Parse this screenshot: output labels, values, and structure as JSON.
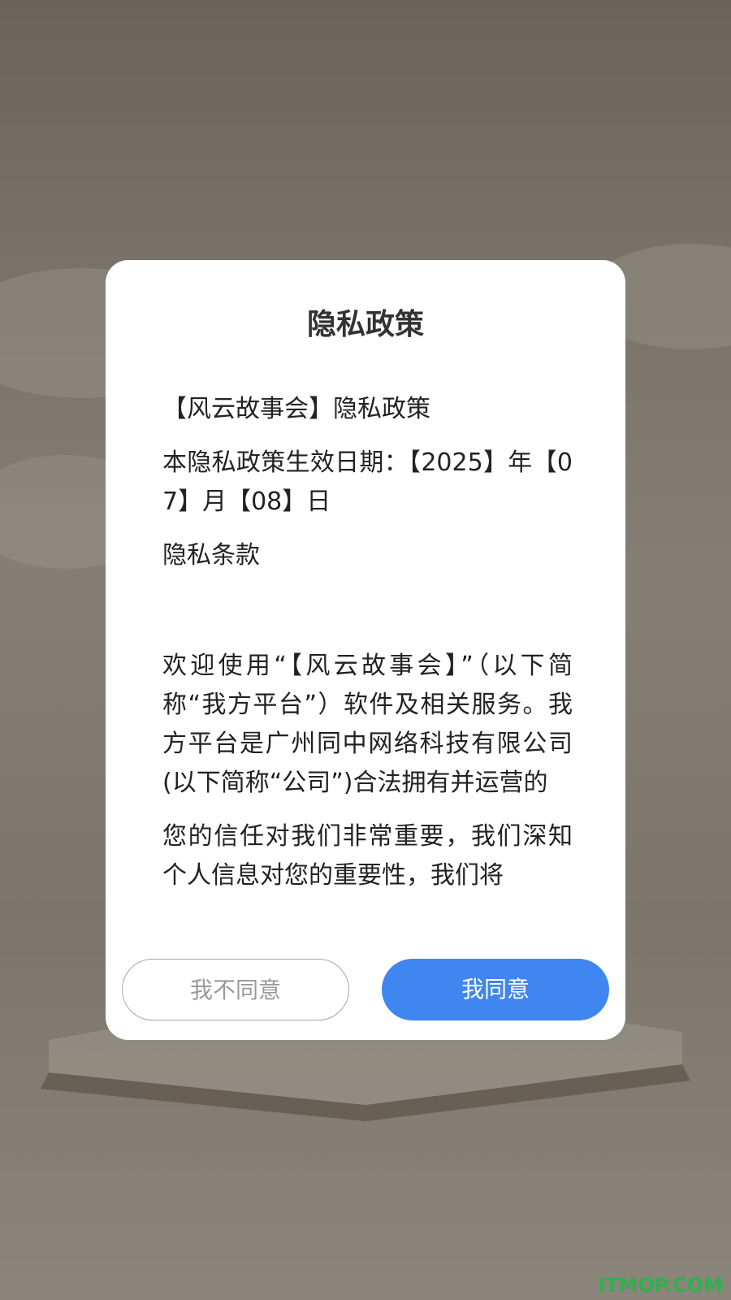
{
  "dialog": {
    "title": "隐私政策",
    "paragraphs": [
      "【风云故事会】隐私政策",
      "本隐私政策生效日期：【2025】年【07】月【08】日",
      "隐私条款",
      "欢迎使用“【风云故事会】”（以下简称“我方平台”）软件及相关服务。我方平台是广州同中网络科技有限公司(以下简称“公司”)合法拥有并运营的",
      "您的信任对我们非常重要，我们深知个人信息对您的重要性，我们将"
    ],
    "buttons": {
      "disagree": "我不同意",
      "agree": "我同意"
    }
  },
  "watermark": "ITMOP.COM",
  "colors": {
    "primary": "#3f86f0",
    "watermark": "#2bb24c"
  }
}
